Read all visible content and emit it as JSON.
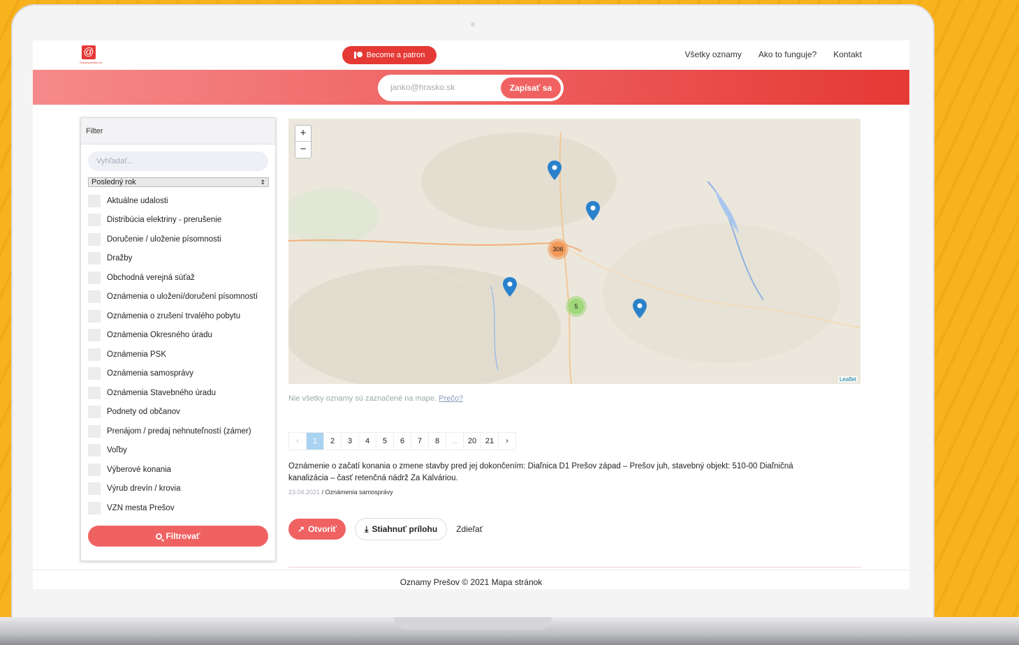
{
  "header": {
    "logo_text": "Oznamyhrasko.sk",
    "patron_label": "Become a patron",
    "nav": [
      "Všetky oznamy",
      "Ako to funguje?",
      "Kontakt"
    ]
  },
  "subscribe": {
    "placeholder": "janko@hrasko.sk",
    "button": "Zapísať sa"
  },
  "filter": {
    "title": "Filter",
    "search_placeholder": "Vyhľadať...",
    "period_selected": "Posledný rok",
    "categories": [
      "Aktuálne udalosti",
      "Distribúcia elektriny - prerušenie",
      "Doručenie / uloženie písomnosti",
      "Dražby",
      "Obchodná verejná súťaž",
      "Oznámenia o uložení/doručení písomností",
      "Oznámenia o zrušení trvalého pobytu",
      "Oznámenia Okresného úradu",
      "Oznámenia PSK",
      "Oznámenia samosprávy",
      "Oznámenia Stavebného úradu",
      "Podnety od občanov",
      "Prenájom / predaj nehnuteľností (zámer)",
      "Voľby",
      "Výberové konania",
      "Výrub drevín / krovia",
      "VZN mesta Prešov"
    ],
    "button": "Filtrovať"
  },
  "map": {
    "clusters": [
      "306",
      "5"
    ],
    "attribution": "Leaflet",
    "note": "Nie všetky oznamy sú zaznačené na mape.",
    "note_link": "Prečo?",
    "colors": {
      "cluster_large": "#f39a5a",
      "cluster_small": "#9fd779",
      "marker": "#2a81cb"
    }
  },
  "pagination": {
    "prev": "‹",
    "pages": [
      "1",
      "2",
      "3",
      "4",
      "5",
      "6",
      "7",
      "8",
      "...",
      "20",
      "21"
    ],
    "next": "›",
    "current": "1"
  },
  "item": {
    "title": "Oznámenie o začatí konania o zmene stavby pred jej dokončením: Diaľnica D1 Prešov západ – Prešov juh, stavebný objekt: 510-00 Diaľničná kanalizácia – časť retenčná nádrž Za Kalváriou.",
    "date": "23.04.2021",
    "category": "/ Oznámenia samosprávy",
    "open_label": "Otvoriť",
    "download_label": "Stiahnuť prílohu",
    "share_label": "Zdieľať"
  },
  "footer": {
    "text": "Oznamy Prešov © 2021 Mapa stránok"
  },
  "colors": {
    "accent": "#e53935",
    "accent_light": "#f06262",
    "background": "#f7b21e"
  }
}
